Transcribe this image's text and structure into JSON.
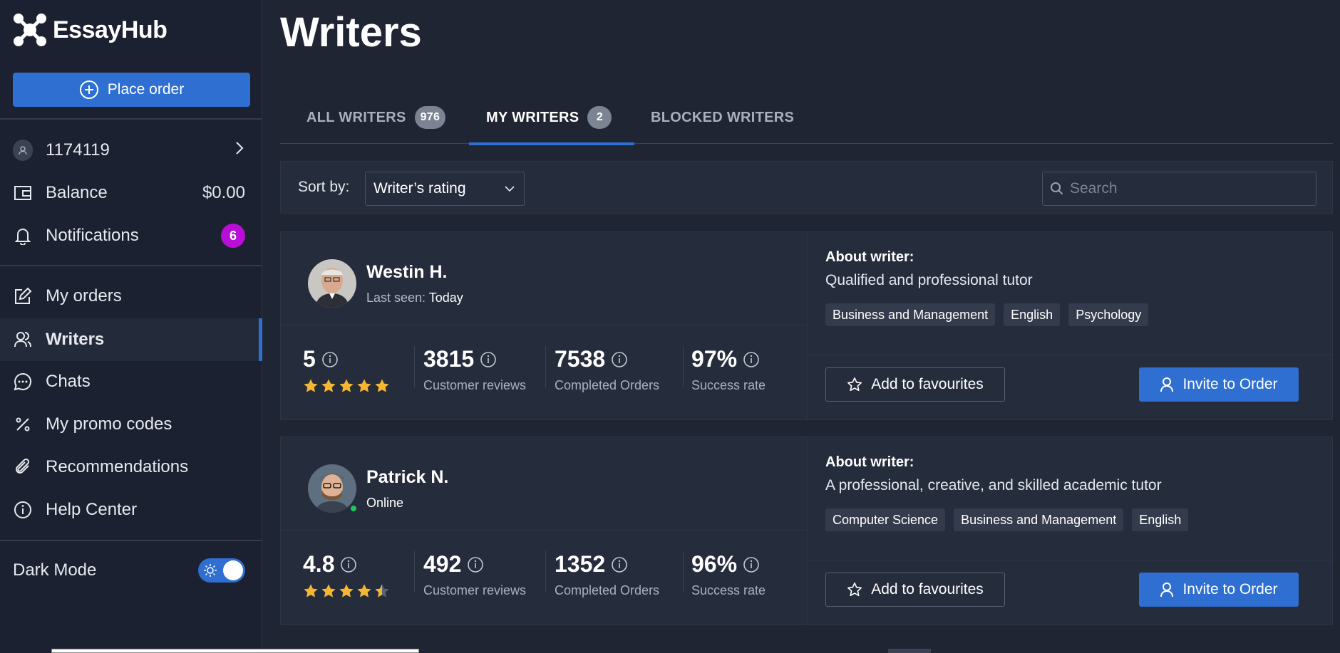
{
  "app": {
    "name": "EssayHub"
  },
  "sidebar": {
    "place_order_label": "Place order",
    "user_id": "1174119",
    "balance_label": "Balance",
    "balance_value": "$0.00",
    "notifications_label": "Notifications",
    "notifications_count": "6",
    "items": [
      {
        "label": "My orders",
        "icon": "edit-icon"
      },
      {
        "label": "Writers",
        "icon": "users-icon",
        "active": true
      },
      {
        "label": "Chats",
        "icon": "chat-icon"
      },
      {
        "label": "My promo codes",
        "icon": "percent-icon"
      },
      {
        "label": "Recommendations",
        "icon": "paperclip-icon"
      },
      {
        "label": "Help Center",
        "icon": "info-icon"
      }
    ],
    "dark_mode_label": "Dark Mode",
    "dark_mode_on": true
  },
  "main": {
    "title": "Writers",
    "tabs": [
      {
        "label": "ALL WRITERS",
        "count": "976"
      },
      {
        "label": "MY WRITERS",
        "count": "2",
        "selected": true
      },
      {
        "label": "BLOCKED WRITERS"
      }
    ],
    "sort_label": "Sort by:",
    "sort_value": "Writer’s rating",
    "search_placeholder": "Search"
  },
  "writers": [
    {
      "name": "Westin H.",
      "status_prefix": "Last seen: ",
      "status_value": "Today",
      "rating": "5",
      "rating_stars": 5,
      "reviews": "3815",
      "reviews_label": "Customer reviews",
      "orders": "7538",
      "orders_label": "Completed Orders",
      "success": "97%",
      "success_label": "Success rate",
      "about_heading": "About writer:",
      "about_text": "Qualified and professional tutor",
      "tags": [
        "Business and Management",
        "English",
        "Psychology"
      ],
      "fav_label": "Add to favourites",
      "invite_label": "Invite to Order"
    },
    {
      "name": "Patrick N.",
      "status_prefix": "",
      "status_value": "Online",
      "rating": "4.8",
      "rating_stars": 4.5,
      "reviews": "492",
      "reviews_label": "Customer reviews",
      "orders": "1352",
      "orders_label": "Completed Orders",
      "success": "96%",
      "success_label": "Success rate",
      "about_heading": "About writer:",
      "about_text": "A professional, creative, and skilled academic tutor",
      "tags": [
        "Computer Science",
        "Business and Management",
        "English"
      ],
      "fav_label": "Add to favourites",
      "invite_label": "Invite to Order"
    }
  ],
  "colors": {
    "accent": "#2f6fd1",
    "badge": "#b70fd7",
    "star": "#f5b731"
  }
}
